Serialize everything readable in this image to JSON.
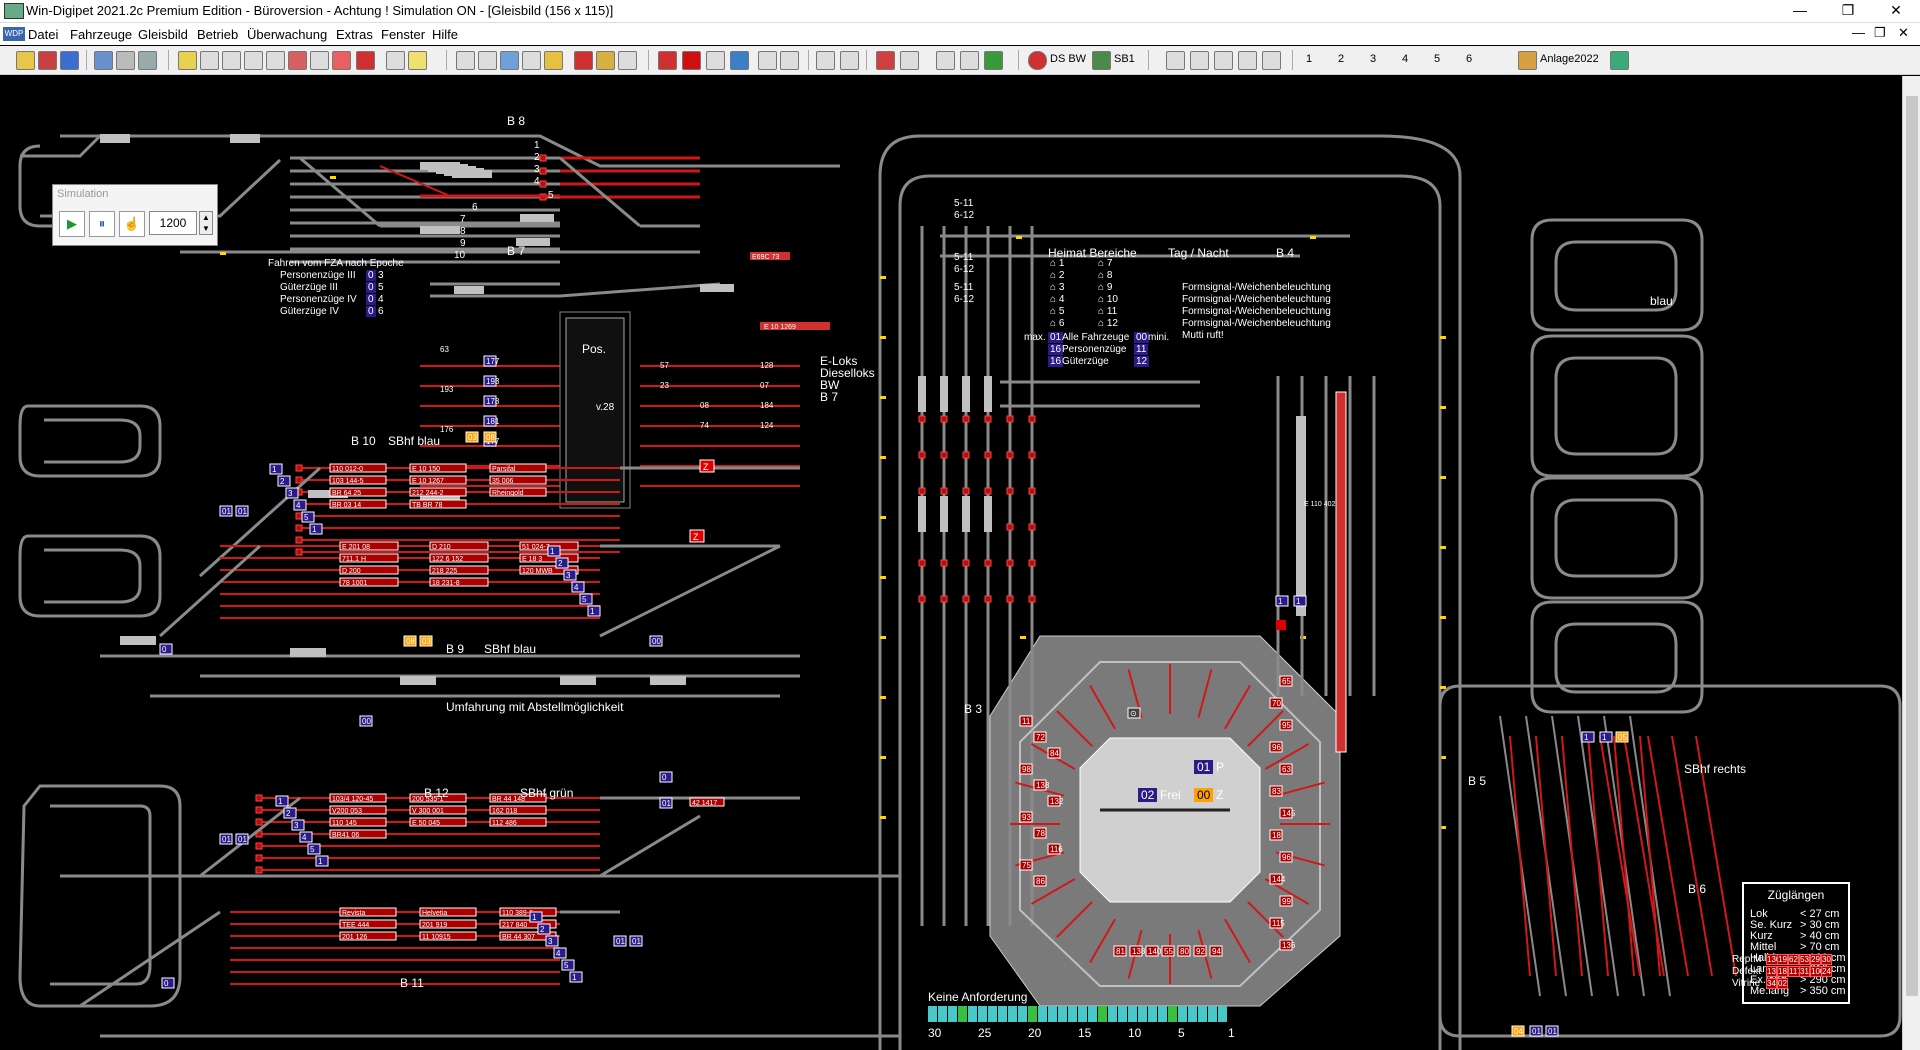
{
  "window": {
    "title": "Win-Digipet 2021.2c Premium Edition - Büroversion - Achtung ! Simulation ON - [Gleisbild (156 x 115)]",
    "minimize": "—",
    "restore": "❐",
    "close": "✕"
  },
  "menu": {
    "logo": "WDP",
    "items": [
      "Datei",
      "Fahrzeuge",
      "Gleisbild",
      "Betrieb",
      "Überwachung",
      "Extras",
      "Fenster",
      "Hilfe"
    ],
    "mdi_minimize": "—",
    "mdi_restore": "❐",
    "mdi_close": "✕"
  },
  "toolbar": {
    "ds_bw": "DS BW",
    "sb1": "SB1",
    "profile_numbers": [
      "1",
      "2",
      "3",
      "4",
      "5",
      "6"
    ],
    "layout_name": "Anlage2022"
  },
  "simulation": {
    "title": "Simulation",
    "play": "▶",
    "pause": "⏸",
    "hand": "☝",
    "value": "1200"
  },
  "track_labels": {
    "b8": "B 8",
    "b7": "B 7",
    "b10": "B 10",
    "sbhf_blau_1": "SBhf blau",
    "b9": "B 9",
    "sbhf_blau_2": "SBhf blau",
    "umfahrung": "Umfahrung mit Abstellmöglichkeit",
    "b12": "B 12",
    "sbhf_gruen": "SBhf grün",
    "b11": "B 11",
    "b3": "B 3",
    "b4": "B 4",
    "b5": "B 5",
    "b6": "B 6",
    "sbhf_rechts": "SBhf rechts",
    "blau": "blau",
    "eloks": "E-Loks",
    "dieselloks": "Dieselloks",
    "bw": "BW",
    "b7b": "B 7",
    "pos": "Pos.",
    "v28": "v.28",
    "heimat_bereiche": "Heimat Bereiche",
    "tag_nacht": "Tag / Nacht",
    "track_nums_b8": [
      "1",
      "2",
      "3",
      "4",
      "5"
    ],
    "track_nums_b7": [
      "6",
      "7",
      "8",
      "9",
      "10"
    ],
    "signal_511": "5-11",
    "signal_612": "6-12"
  },
  "fza_epoche": {
    "title": "Fahren vom FZA nach Epoche",
    "rows": [
      {
        "label": "Personenzüge III",
        "badge": "0",
        "value": "3"
      },
      {
        "label": "Güterzüge III",
        "badge": "0",
        "value": "5"
      },
      {
        "label": "Personenzüge IV",
        "badge": "0",
        "value": "4"
      },
      {
        "label": "Güterzüge IV",
        "badge": "0",
        "value": "6"
      }
    ]
  },
  "heimat": {
    "left": [
      "1",
      "2",
      "3",
      "4",
      "5",
      "6"
    ],
    "right": [
      "7",
      "8",
      "9",
      "10",
      "11",
      "12"
    ],
    "max_label": "max.",
    "badge_01": "01",
    "alle": "Alle Fahrzeuge",
    "badge_00": "00",
    "mini": "mini.",
    "pers_badge": "16",
    "pers": "Personenzüge",
    "pers_val": "11",
    "gueter_badge": "16",
    "gueter": "Güterzüge",
    "gueter_val": "12"
  },
  "tagnacht": {
    "rows": [
      "Formsignal-/Weichenbeleuchtung",
      "Formsignal-/Weichenbeleuchtung",
      "Formsignal-/Weichenbeleuchtung",
      "Formsignal-/Weichenbeleuchtung"
    ],
    "mutti": "Mutti ruft!"
  },
  "bw_numbers": {
    "col1": [
      "63",
      "193",
      "176",
      "178"
    ],
    "col2": [
      "177",
      "193",
      "178",
      "181"
    ],
    "col3": [
      "191",
      "176",
      "178",
      "101"
    ],
    "col4": [
      "57",
      "23",
      "",
      ""
    ],
    "col5": [
      "08",
      "74",
      "",
      ""
    ],
    "col6": [
      "128",
      "07",
      "184",
      "124"
    ],
    "mid": [
      "23",
      "74",
      "07"
    ]
  },
  "train_labels_b10": [
    "110 012-0",
    "E 10 150",
    "Parsifal",
    "103 144-5",
    "E 10 1267",
    "35 006",
    "BR 64 25",
    "212 244-2",
    "Rheingold",
    "BR 03 14",
    "TB BR 78"
  ],
  "train_labels_b9": [
    "E 201 08",
    "D 210",
    "51 024-7",
    "711.1 H",
    "122 6 152",
    "E 18 3",
    "D 200",
    "218 225",
    "120 MWB",
    "78 1001",
    "18 231-8"
  ],
  "train_labels_b12": [
    "103/4 120-45",
    "200 535-1",
    "BR 44 148",
    "V200 053",
    "V 300 001",
    "162 018",
    "110 145",
    "E 50 045",
    "112 486",
    "BR41 06"
  ],
  "train_labels_b11": [
    "Revista",
    "Helvetia",
    "110 389-6",
    "TEE 444",
    "201 919",
    "217 840",
    "201 126",
    "11 10915",
    "BR 44 307",
    "42 1417"
  ],
  "turntable": {
    "frei": "Frei",
    "badge_02": "02",
    "z_badge": "00",
    "z": "Z",
    "p_badge": "01",
    "p": "P",
    "bottom_nums": [
      "81",
      "138",
      "140",
      "55",
      "80",
      "92",
      "94"
    ],
    "left_nums": [
      "11",
      "72",
      "84",
      "98",
      "138",
      "132",
      "93",
      "78",
      "116",
      "75",
      "86"
    ],
    "right_nums": [
      "65",
      "70",
      "95",
      "96",
      "63",
      "83",
      "145",
      "18",
      "96",
      "144",
      "99",
      "115",
      "136"
    ]
  },
  "zuglaengen": {
    "title": "Züglängen",
    "rows": [
      {
        "k": "Lok",
        "v": "< 27 cm"
      },
      {
        "k": "Se. Kurz",
        "v": "> 30 cm"
      },
      {
        "k": "Kurz",
        "v": "> 40 cm"
      },
      {
        "k": "Mittel",
        "v": "> 70 cm"
      },
      {
        "k": "Halbl.",
        "v": "> 120 cm"
      },
      {
        "k": "Lang",
        "v": "> 210 cm"
      },
      {
        "k": "Ex.lang",
        "v": "> 290 cm"
      },
      {
        "k": "Me.lang",
        "v": "> 350 cm"
      }
    ]
  },
  "repair": {
    "labels": [
      "Rep.M",
      "Defekt",
      "Vitrine"
    ],
    "row1": [
      "130",
      "19",
      "62",
      "53",
      "29",
      "30"
    ],
    "row2": [
      "13",
      "18",
      "117",
      "31",
      "100",
      "24"
    ],
    "row3": [
      "34",
      "02"
    ]
  },
  "anforderung": {
    "title": "Keine Anforderung",
    "scale": [
      "30",
      "25",
      "20",
      "15",
      "10",
      "5",
      "1"
    ]
  },
  "colors": {
    "track": "#8a8a8a",
    "route_red": "#d01818",
    "signal_yellow": "#ffd800",
    "badge_purple": "#2a1a8a",
    "badge_orange": "#ffa200",
    "turntable_grey": "#9a9a9a"
  }
}
